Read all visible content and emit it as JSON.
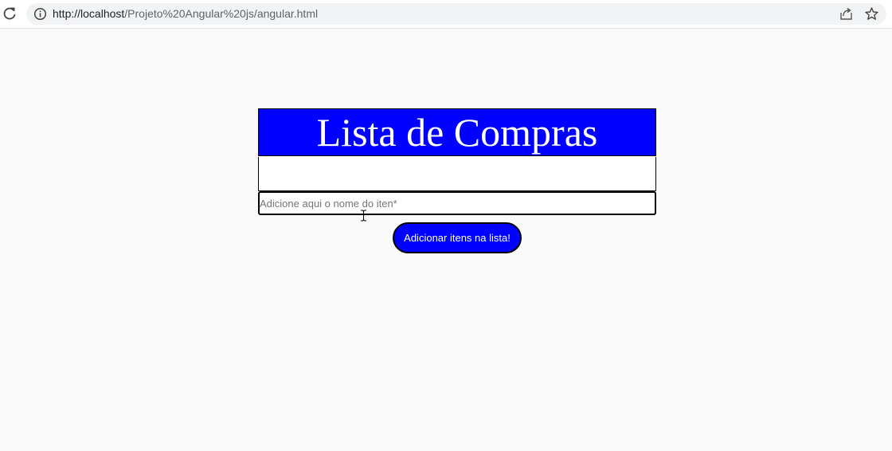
{
  "browser": {
    "url_host": "http://localhost",
    "url_path": "/Projeto%20Angular%20js/angular.html",
    "icons": [
      "reload-icon",
      "info-icon",
      "share-icon",
      "star-icon"
    ]
  },
  "app": {
    "title": "Lista de Compras",
    "input_placeholder": "Adicione aqui o nome do iten*",
    "input_value": "",
    "add_button_label": "Adicionar itens na lista!"
  },
  "colors": {
    "accent": "#0000ff",
    "page_background": "#fafafa"
  }
}
